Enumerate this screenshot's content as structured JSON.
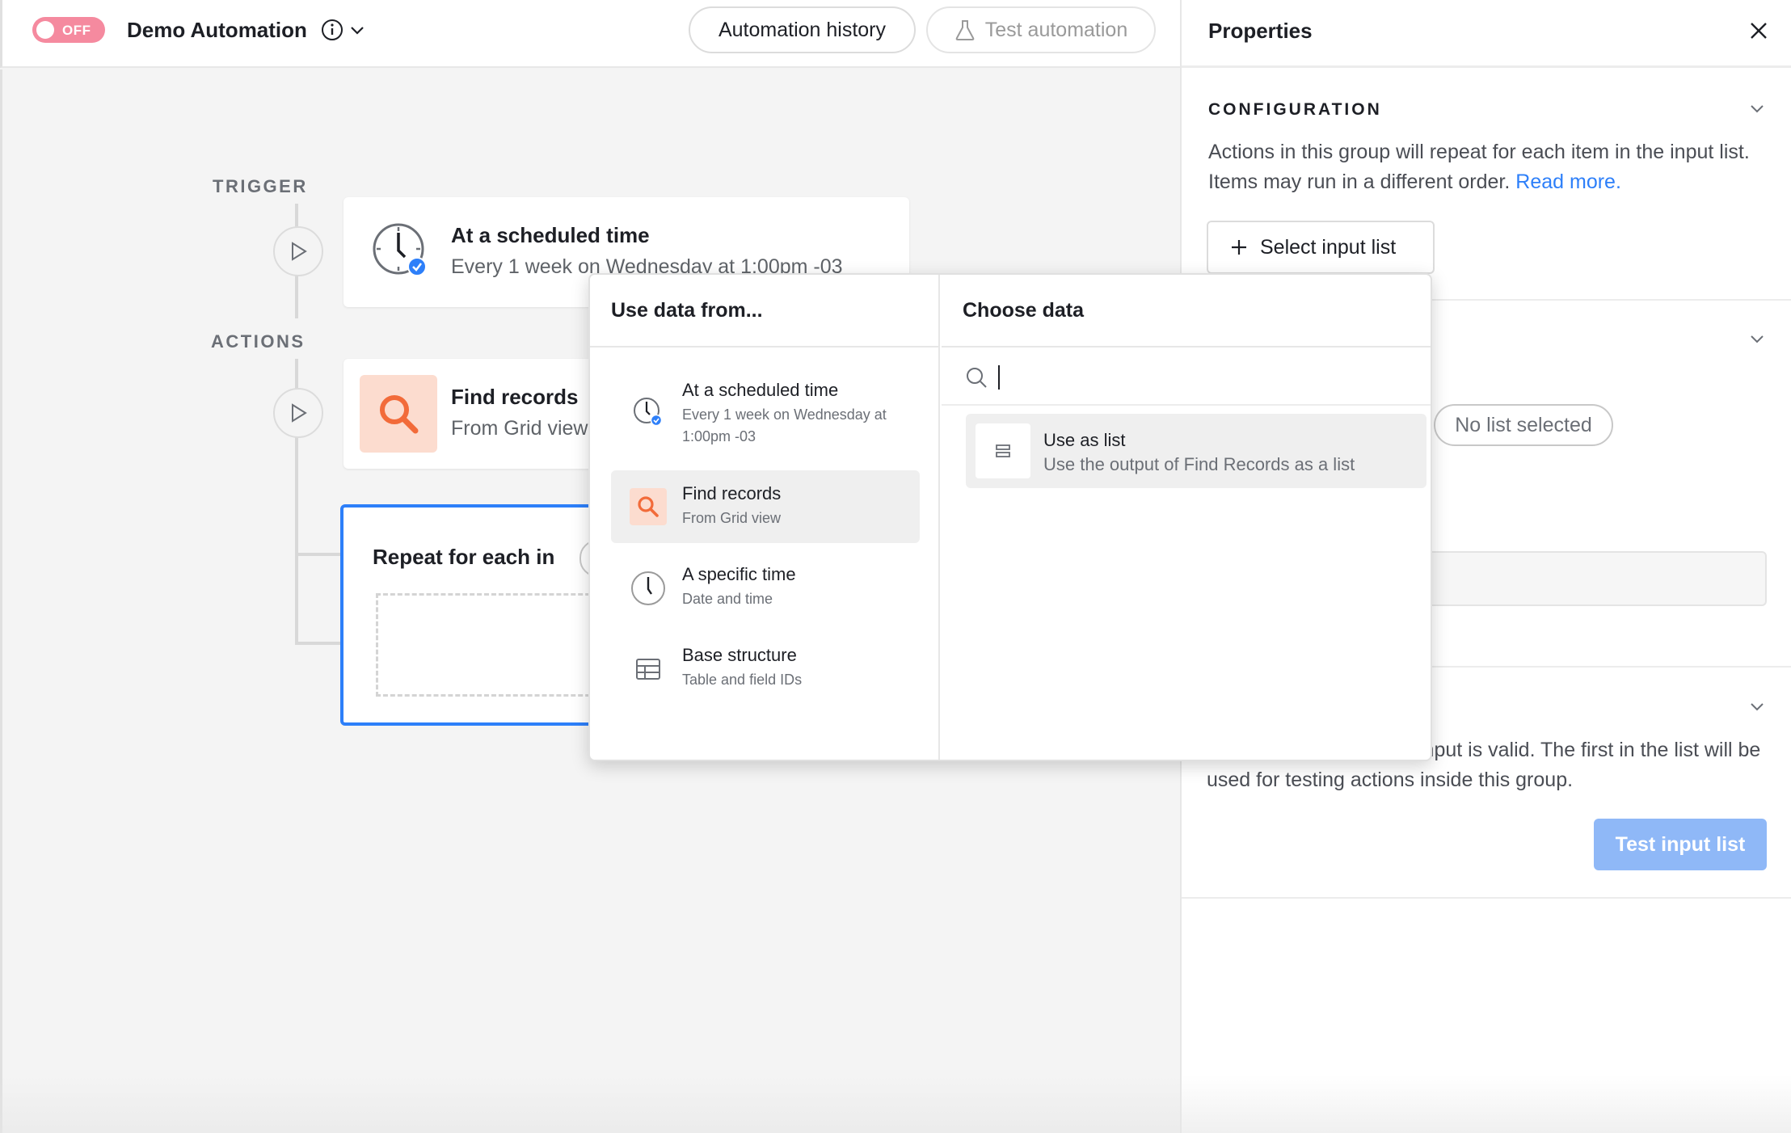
{
  "topbar": {
    "toggle_label": "OFF",
    "title": "Demo Automation",
    "history_button": "Automation history",
    "test_button": "Test automation"
  },
  "canvas": {
    "trigger_label": "TRIGGER",
    "actions_label": "ACTIONS",
    "trigger_card": {
      "title": "At a scheduled time",
      "subtitle": "Every 1 week on Wednesday at 1:00pm -03"
    },
    "find_card": {
      "title": "Find records",
      "subtitle": "From Grid view"
    },
    "repeat_card": {
      "title": "Repeat for each in"
    }
  },
  "popover": {
    "left_heading": "Use data from...",
    "right_heading": "Choose data",
    "items": [
      {
        "title": "At a scheduled time",
        "subtitle": "Every 1 week on Wednesday at 1:00pm -03",
        "icon": "clock-check-icon"
      },
      {
        "title": "Find records",
        "subtitle": "From Grid view",
        "icon": "search-orange-icon"
      },
      {
        "title": "A specific time",
        "subtitle": "Date and time",
        "icon": "clock-icon"
      },
      {
        "title": "Base structure",
        "subtitle": "Table and field IDs",
        "icon": "table-icon"
      }
    ],
    "search_placeholder": "",
    "option": {
      "title": "Use as list",
      "subtitle": "Use the output of Find Records as a list"
    }
  },
  "panel": {
    "title": "Properties",
    "config_label": "CONFIGURATION",
    "config_desc": "Actions in this group will repeat for each item in the input list. Items may run in a different order.",
    "config_link": "Read more.",
    "select_button": "Select input list",
    "no_list_badge": "No list selected",
    "test_desc": "input is valid. The first in the list will be used for testing actions inside this group.",
    "test_button": "Test input list"
  },
  "colors": {
    "accent_blue": "#2d7ff9",
    "toggle_pink": "#f58a9f",
    "search_orange": "#f26b3a"
  }
}
